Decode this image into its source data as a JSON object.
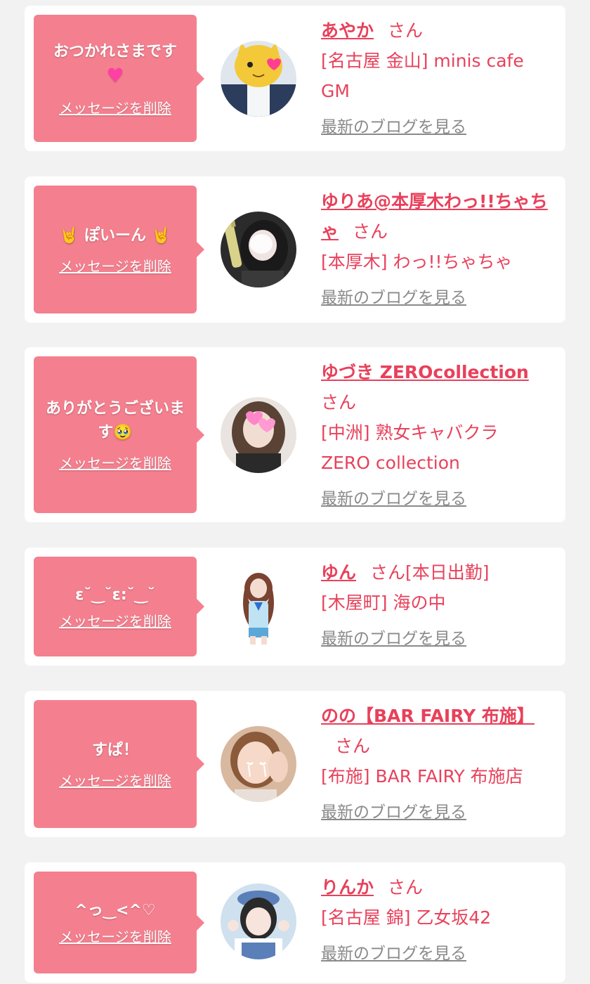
{
  "cards": [
    {
      "message": "おつかれさまです",
      "message_emoji": "♥",
      "delete_label": "メッセージを削除",
      "name": "あやか",
      "honorific": "さん",
      "status": "",
      "shop": "[名古屋 金山] minis cafe GM",
      "blog_label": "最新のブログを見る",
      "avatar_icon": "avatar-photo-icon"
    },
    {
      "message_prefix": "🤘",
      "message": "ぽいーん",
      "message_suffix": "🤘",
      "delete_label": "メッセージを削除",
      "name": "ゆりあ@本厚木わっ!!ちゃちゃ",
      "honorific": "さん",
      "status": "",
      "shop": "[本厚木] わっ!!ちゃちゃ",
      "blog_label": "最新のブログを見る",
      "avatar_icon": "avatar-photo-icon"
    },
    {
      "message": "ありがとうございます",
      "message_emoji": "🥹",
      "delete_label": "メッセージを削除",
      "name": "ゆづき ZEROcollection",
      "honorific": "さん",
      "status": "",
      "shop": "[中洲] 熟女キャバクラ ZERO collection",
      "blog_label": "最新のブログを見る",
      "avatar_icon": "avatar-photo-icon"
    },
    {
      "message": "ε˘‿˘ε:˘‿˘",
      "delete_label": "メッセージを削除",
      "name": "ゆん",
      "honorific": "さん",
      "status": "[本日出勤]",
      "shop": "[木屋町] 海の中",
      "blog_label": "最新のブログを見る",
      "avatar_icon": "avatar-photo-icon"
    },
    {
      "message": "すぱ！",
      "delete_label": "メッセージを削除",
      "name": "のの【BAR FAIRY 布施】",
      "honorific": "さん",
      "status": "",
      "shop": "[布施] BAR FAIRY 布施店",
      "blog_label": "最新のブログを見る",
      "avatar_icon": "avatar-photo-icon"
    },
    {
      "message": "^っ‿<^♡",
      "delete_label": "メッセージを削除",
      "name": "りんか",
      "honorific": "さん",
      "status": "",
      "shop": "[名古屋 錦] 乙女坂42",
      "blog_label": "最新のブログを見る",
      "avatar_icon": "avatar-photo-icon"
    }
  ],
  "colors": {
    "bubble_pink": "#f4808f",
    "accent_red": "#e8415b",
    "link_gray": "#8a8a8a",
    "page_bg": "#f2f2f2"
  }
}
